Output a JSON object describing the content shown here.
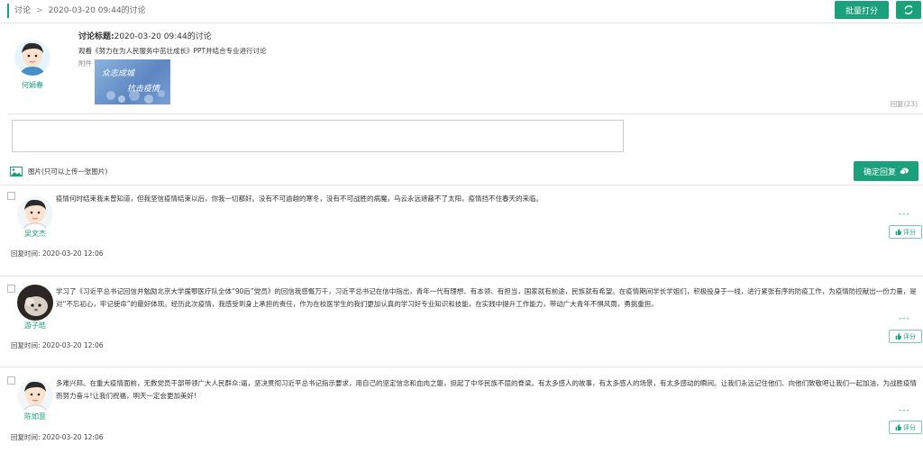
{
  "breadcrumb": {
    "root": "讨论",
    "sep": ">",
    "current": "2020-03-20 09:44的讨论"
  },
  "toolbar": {
    "batch_score_label": "批量打分",
    "refresh_icon": "refresh-icon"
  },
  "topic": {
    "author": "何娟春",
    "title_label": "讨论标题:",
    "title_value": "2020-03-20 09:44的讨论",
    "description": "观看《努力在为人民服务中茁壮成长》PPT并结合专业进行讨论",
    "attachment_label": "附件",
    "attachment_image_text_1": "众志成城",
    "attachment_image_text_2": "抗击疫情",
    "reply_count": "回复(23)"
  },
  "reply_form": {
    "image_hint": "图片(只可以上传一张图片)",
    "submit_label": "确定回复"
  },
  "replies": [
    {
      "author": "吴文杰",
      "text": "疫情何时结束我未曾知道，但我坚信疫情结束以后，你我一切都好。没有不可逾越的寒冬，没有不可战胜的病魔，乌云永远遮蔽不了太阳，疫情挡不住春天的来临。",
      "time": "回复时间: 2020-03-20 12:06",
      "rate_label": "评分",
      "dashes": "---"
    },
    {
      "author": "游子皓",
      "text": "学习了《习近平总书记回信并勉励北京大学援鄂医疗队全体“90后”党员》的回信我感慨万千，习近平总书记在信中指出，青年一代有理想、有本领、有担当，国家就有前途，民族就有希望。在疫情期间学长学姐们，积极投身于一线，进行紧张有序的防疫工作，为疫情防控献出一份力量，是对“不忘初心，牢记使命”的最好体现。经历此次疫情，我感受到身上承担的责任，作为在校医学生的我们更加认真的学习好专业知识和技能，在实践中提升工作能力，带动广大青年不惧风雨，勇挑重担。",
      "time": "回复时间: 2020-03-20 12:06",
      "rate_label": "评分",
      "dashes": "---"
    },
    {
      "author": "陈如意",
      "text": "多难兴邦。在重大疫情面前，无数党员干部带领广大人民群众:逼，坚决贯彻习近平总书记指示要求，用自己的坚定信念和血肉之躯，挺起了中华民族不屈的脊梁。有太多感人的故事，有太多感人的场景，有太多感动的瞬间。让我们永远记住他们、向他们致敬吧让我们一起加油，为战胜疫情而努力奋斗!让我们祝福，明天一定会更加美好!",
      "time": "回复时间: 2020-03-20 12:06",
      "rate_label": "评分",
      "dashes": "---"
    }
  ]
}
